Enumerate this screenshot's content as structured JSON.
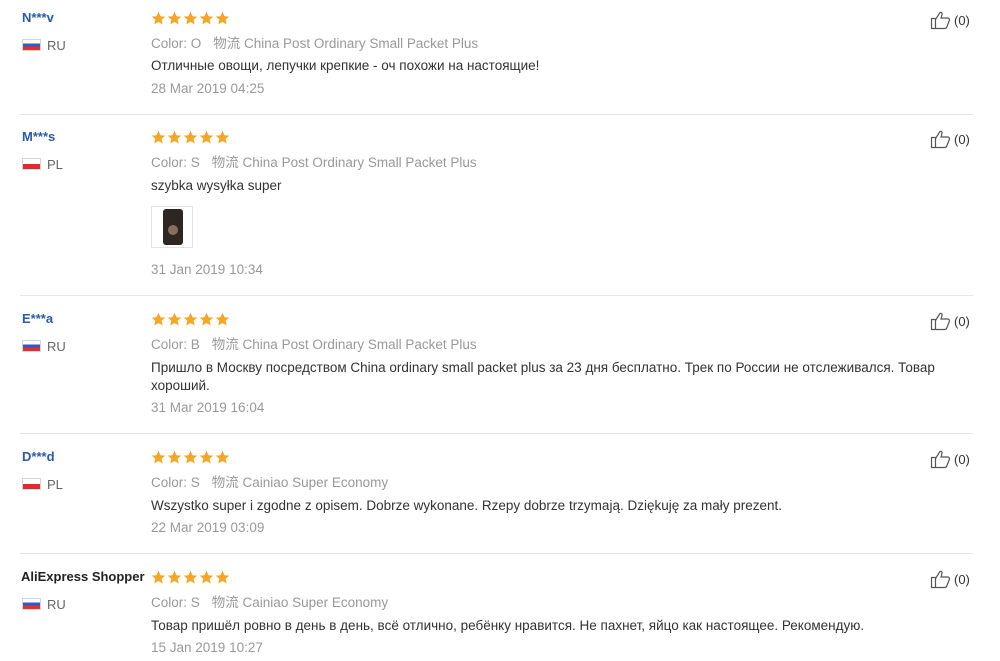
{
  "reviews": [
    {
      "user": "N***v",
      "country": "RU",
      "flag": "russia-flag-icon",
      "rating": 5,
      "color_label": "Color: O",
      "logistics_label": "物流",
      "logistics": "China Post Ordinary Small Packet Plus",
      "text": "Отличные овощи, лепучки крепкие - оч похожи на настоящие!",
      "date": "28 Mar 2019 04:25",
      "helpful_count": "(0)"
    },
    {
      "user": "M***s",
      "country": "PL",
      "flag": "poland-flag-icon",
      "rating": 5,
      "color_label": "Color: S",
      "logistics_label": "物流",
      "logistics": "China Post Ordinary Small Packet Plus",
      "text": "szybka wysyłka super",
      "date": "31 Jan 2019 10:34",
      "helpful_count": "(0)"
    },
    {
      "user": "E***a",
      "country": "RU",
      "flag": "russia-flag-icon",
      "rating": 5,
      "color_label": "Color: B",
      "logistics_label": "物流",
      "logistics": "China Post Ordinary Small Packet Plus",
      "text": "Пришло в Москву посредством China ordinary small packet plus за 23 дня бесплатно. Трек по России не отслеживался. Товар хороший.",
      "date": "31 Mar 2019 16:04",
      "helpful_count": "(0)"
    },
    {
      "user": "D***d",
      "country": "PL",
      "flag": "poland-flag-icon",
      "rating": 5,
      "color_label": "Color: S",
      "logistics_label": "物流",
      "logistics": "Cainiao Super Economy",
      "text": "Wszystko super i zgodne z opisem. Dobrze wykonane. Rzepy dobrze trzymają. Dziękuję za mały prezent.",
      "date": "22 Mar 2019 03:09",
      "helpful_count": "(0)"
    },
    {
      "user": "AliExpress Shopper",
      "country": "RU",
      "flag": "russia-flag-icon",
      "rating": 5,
      "color_label": "Color: S",
      "logistics_label": "物流",
      "logistics": "Cainiao Super Economy",
      "text": "Товар пришёл ровно в день в день, всё отлично, ребёнку нравится. Не пахнет, яйцо как настоящее. Рекомендую.",
      "date": "15 Jan 2019 10:27",
      "helpful_count": "(0)"
    }
  ],
  "colors": {
    "star": "#f6a623",
    "username": "#2b5aa8",
    "muted": "#999999",
    "divider": "#e6e6e6"
  }
}
